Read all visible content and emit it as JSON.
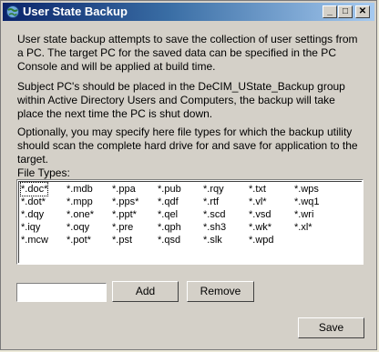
{
  "window": {
    "title": "User State Backup",
    "controls": {
      "minimize": "_",
      "maximize": "□",
      "close": "✕"
    }
  },
  "description": {
    "p1": "User state backup attempts to save the collection of user settings from a PC. The target PC for the saved data can be specified in the PC Console and will be applied at build time.",
    "p2": "Subject PC's should be placed in the DeCIM_UState_Backup group within Active Directory Users and Computers, the backup will take place the next time the PC is shut down.",
    "p3": "Optionally, you may specify here file types for which the backup utility should scan the complete hard drive for and save for application to the target."
  },
  "file_types": {
    "label": "File Types:",
    "columns": [
      [
        "*.doc*",
        "*.dot*",
        "*.dqy",
        "*.iqy",
        "*.mcw"
      ],
      [
        "*.mdb",
        "*.mpp",
        "*.one*",
        "*.oqy",
        "*.pot*"
      ],
      [
        "*.ppa",
        "*.pps*",
        "*.ppt*",
        "*.pre",
        "*.pst"
      ],
      [
        "*.pub",
        "*.qdf",
        "*.qel",
        "*.qph",
        "*.qsd"
      ],
      [
        "*.rqy",
        "*.rtf",
        "*.scd",
        "*.sh3",
        "*.slk"
      ],
      [
        "*.txt",
        "*.vl*",
        "*.vsd",
        "*.wk*",
        "*.wpd"
      ],
      [
        "*.wps",
        "*.wq1",
        "*.wri",
        "*.xl*"
      ]
    ],
    "new_type_value": ""
  },
  "buttons": {
    "add": "Add",
    "remove": "Remove",
    "save": "Save"
  },
  "colors": {
    "titlebar_start": "#0a246a",
    "titlebar_end": "#a6caf0",
    "face": "#d4d0c8"
  }
}
